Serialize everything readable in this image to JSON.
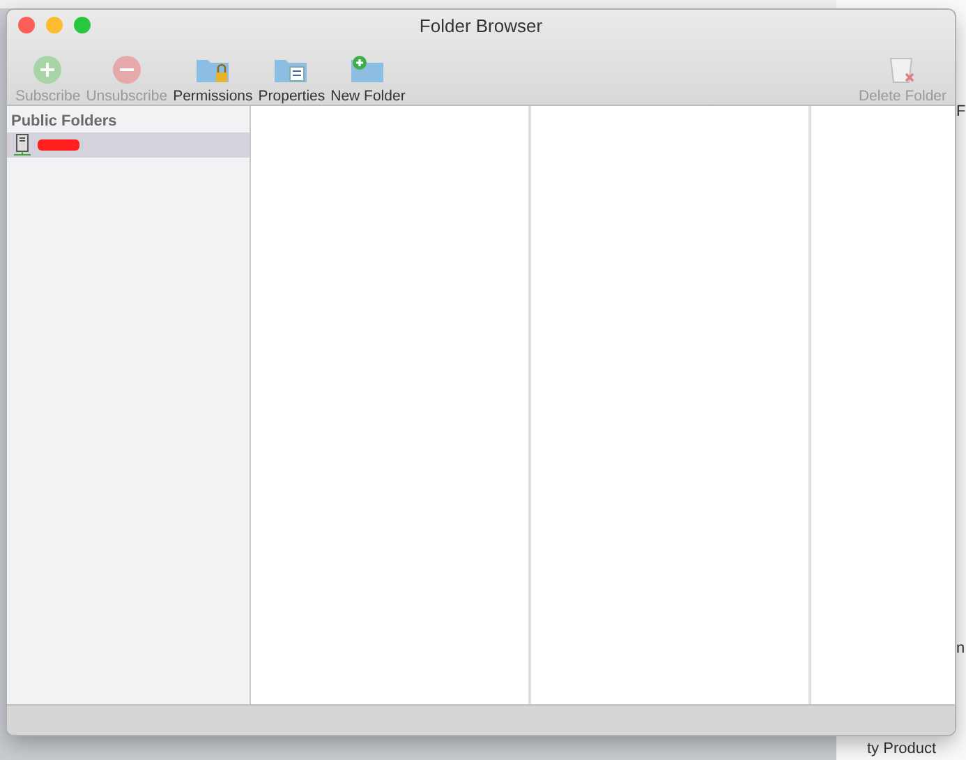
{
  "window": {
    "title": "Folder Browser"
  },
  "toolbar": [
    {
      "kind": "subscribe",
      "label": "Subscribe",
      "disabled": true
    },
    {
      "kind": "unsubscribe",
      "label": "Unsubscribe",
      "disabled": true
    },
    {
      "kind": "permissions",
      "label": "Permissions",
      "disabled": false
    },
    {
      "kind": "properties",
      "label": "Properties",
      "disabled": false
    },
    {
      "kind": "new-folder",
      "label": "New Folder",
      "disabled": false
    },
    {
      "kind": "delete",
      "label": "Delete Folder",
      "disabled": true
    }
  ],
  "sidebar": {
    "header": "Public Folders",
    "items": [
      {
        "kind": "server",
        "selected": true
      }
    ]
  },
  "background_texts": [
    "F",
    "n",
    "ty Product"
  ]
}
